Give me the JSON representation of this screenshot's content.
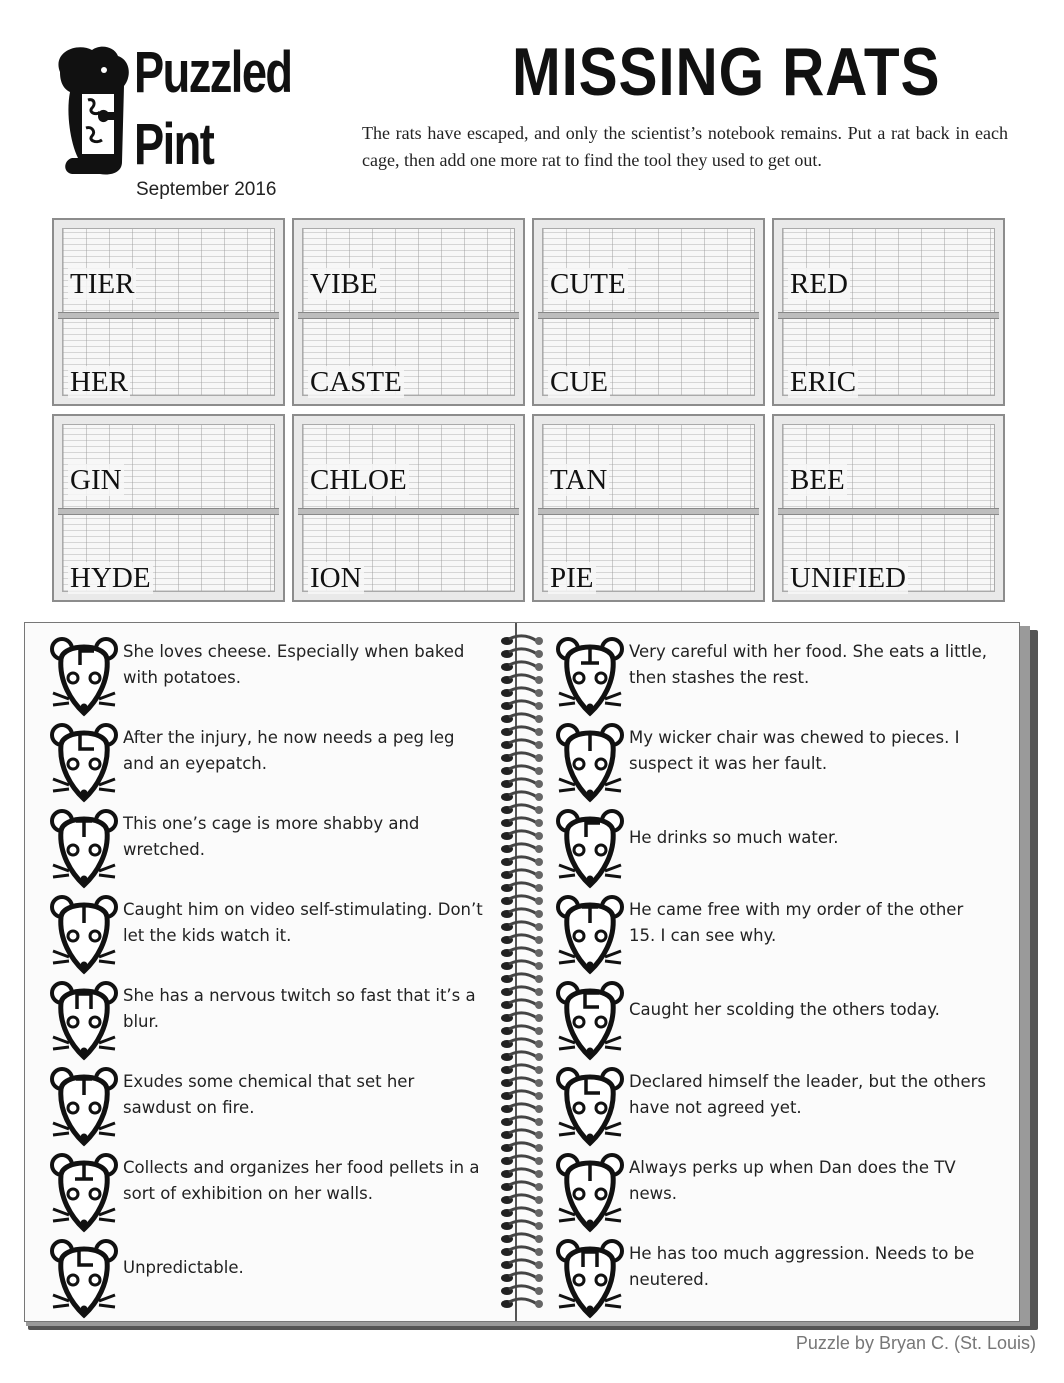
{
  "header": {
    "brand_line1": "Puzzled",
    "brand_line2": "Pint",
    "date": "September 2016",
    "title": "MISSING RATS",
    "intro": "The rats have escaped, and only the scientist’s notebook remains.  Put a rat back in each cage, then add one more rat to find the tool they used to get out."
  },
  "cages": [
    {
      "top": "TIER",
      "bottom": "HER"
    },
    {
      "top": "VIBE",
      "bottom": "CASTE"
    },
    {
      "top": "CUTE",
      "bottom": "CUE"
    },
    {
      "top": "RED",
      "bottom": "ERIC"
    },
    {
      "top": "GIN",
      "bottom": "HYDE"
    },
    {
      "top": "CHLOE",
      "bottom": "ION"
    },
    {
      "top": "TAN",
      "bottom": "PIE"
    },
    {
      "top": "BEE",
      "bottom": "UNIFIED"
    }
  ],
  "notebook": {
    "left": [
      {
        "glyph": "corner-tl",
        "text": "She loves cheese.  Especially when baked with potatoes."
      },
      {
        "glyph": "corner-bl",
        "text": "After the injury, he now needs a peg leg and an eyepatch."
      },
      {
        "glyph": "tee-down",
        "text": "This one’s cage is more shabby and wretched."
      },
      {
        "glyph": "bar",
        "text": "Caught him on video self-stimulating. Don’t let the kids watch it."
      },
      {
        "glyph": "arch",
        "text": "She has a nervous twitch so fast that it’s a blur."
      },
      {
        "glyph": "tee-down",
        "text": "Exudes some chemical that set her sawdust on fire."
      },
      {
        "glyph": "tee-up",
        "text": "Collects and organizes her food pellets in a sort of exhibition on her walls."
      },
      {
        "glyph": "corner-bl2",
        "text": "Unpredictable."
      }
    ],
    "right": [
      {
        "glyph": "tee-up",
        "text": "Very careful with her food.  She eats a little, then stashes the rest."
      },
      {
        "glyph": "bar",
        "text": "My wicker chair was chewed to pieces.  I suspect it was her fault."
      },
      {
        "glyph": "corner-tl",
        "text": "He drinks so much water."
      },
      {
        "glyph": "tee-down",
        "text": "He came free with my order of the other 15.  I can see why."
      },
      {
        "glyph": "bracket",
        "text": "Caught her scolding the others today."
      },
      {
        "glyph": "corner-bl",
        "text": "Declared himself the leader, but the others have not agreed yet."
      },
      {
        "glyph": "bar",
        "text": "Always perks up when Dan does the TV news."
      },
      {
        "glyph": "arch",
        "text": "He has too much aggression.  Needs to be neutered."
      }
    ]
  },
  "credit": "Puzzle by Bryan C. (St. Louis)"
}
